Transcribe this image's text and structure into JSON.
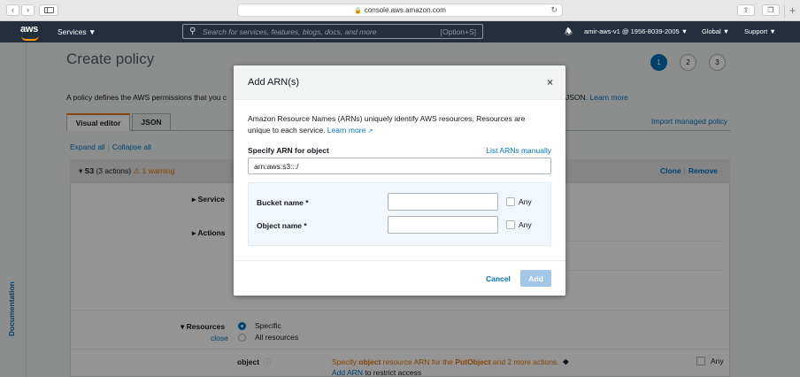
{
  "browser": {
    "url": "console.aws.amazon.com",
    "back": "‹",
    "forward": "›"
  },
  "aws_nav": {
    "logo": "aws",
    "services": "Services ▼",
    "search_placeholder": "Search for services, features, blogs, docs, and more",
    "search_shortcut": "[Option+S]",
    "account": "amir-aws-v1 @ 1956-8039-2005 ▼",
    "region": "Global ▼",
    "support": "Support ▼"
  },
  "side_tab": {
    "label": "Documentation"
  },
  "page": {
    "title": "Create policy",
    "steps": [
      "1",
      "2",
      "3"
    ],
    "desc_left": "A policy defines the AWS permissions that you c",
    "desc_right": "JSON.",
    "learn_more": "Learn more",
    "tabs": [
      "Visual editor",
      "JSON"
    ],
    "import_link": "Import managed policy",
    "expand_all": "Expand all",
    "collapse_all": "Collapse all",
    "service_block": {
      "service": "S3",
      "actions": "(3 actions)",
      "warning": "1 warning",
      "clone": "Clone",
      "remove": "Remove"
    },
    "rows": {
      "service": "Service",
      "actions": "Actions",
      "resources": "Resources",
      "close": "close",
      "specific": "Specific",
      "all_resources": "All resources",
      "object": "object",
      "object_note_pre": "Specify ",
      "object_note_bold1": "object",
      "object_note_mid": " resource ARN for the ",
      "object_note_bold2": "PutObject",
      "object_note_post": " and 2 more actions.",
      "add_arn": "Add ARN",
      "add_arn_suffix": " to restrict access",
      "any": "Any"
    }
  },
  "modal": {
    "title": "Add ARN(s)",
    "close": "×",
    "description": "Amazon Resource Names (ARNs) uniquely identify AWS resources. Resources are unique to each service.",
    "learn_more": "Learn more",
    "specify_label": "Specify ARN for object",
    "list_manually": "List ARNs manually",
    "arn_value": "arn:aws:s3:::/",
    "bucket_label": "Bucket name *",
    "object_label": "Object name *",
    "bucket_value": "",
    "object_value": "",
    "any": "Any",
    "cancel": "Cancel",
    "add": "Add"
  }
}
